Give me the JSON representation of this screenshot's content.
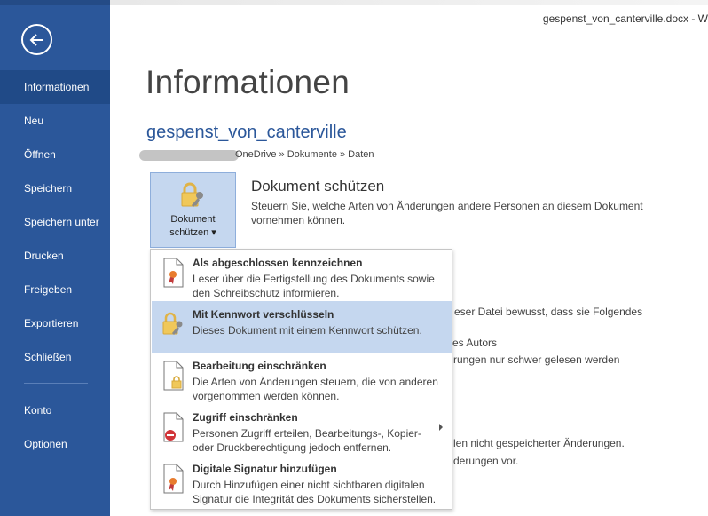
{
  "window": {
    "title": "gespenst_von_canterville.docx - W"
  },
  "sidebar": {
    "items": [
      {
        "label": "Informationen",
        "active": true
      },
      {
        "label": "Neu"
      },
      {
        "label": "Öffnen"
      },
      {
        "label": "Speichern"
      },
      {
        "label": "Speichern unter"
      },
      {
        "label": "Drucken"
      },
      {
        "label": "Freigeben"
      },
      {
        "label": "Exportieren"
      },
      {
        "label": "Schließen"
      },
      {
        "label": "Konto"
      },
      {
        "label": "Optionen"
      }
    ]
  },
  "main": {
    "heading": "Informationen",
    "doc_name": "gespenst_von_canterville",
    "doc_path": "OneDrive » Dokumente » Daten",
    "protect": {
      "button_line1": "Dokument",
      "button_line2": "schützen ▾",
      "title": "Dokument schützen",
      "description": "Steuern Sie, welche Arten von Änderungen andere Personen an diesem Dokument vornehmen können."
    },
    "background_fragments": [
      "eser Datei bewusst, dass sie Folgendes",
      "es Autors",
      "rungen nur schwer gelesen werden",
      "len nicht gespeicherter Änderungen.",
      "derungen vor."
    ]
  },
  "menu": {
    "items": [
      {
        "title": "Als abgeschlossen kennzeichnen",
        "desc": "Leser über die Fertigstellung des Dokuments sowie den Schreibschutz informieren.",
        "icon": "document-ribbon-icon"
      },
      {
        "title": "Mit Kennwort verschlüsseln",
        "desc": "Dieses Dokument mit einem Kennwort schützen.",
        "icon": "lock-key-icon",
        "highlighted": true
      },
      {
        "title": "Bearbeitung einschränken",
        "desc": "Die Arten von Änderungen steuern, die von anderen vorgenommen werden können.",
        "icon": "document-lock-icon"
      },
      {
        "title": "Zugriff einschränken",
        "desc": "Personen Zugriff erteilen, Bearbeitungs-, Kopier- oder Druckberechtigung jedoch entfernen.",
        "icon": "document-restricted-icon",
        "has_submenu": true
      },
      {
        "title": "Digitale Signatur hinzufügen",
        "desc": "Durch Hinzufügen einer nicht sichtbaren digitalen Signatur die Integrität des Dokuments sicherstellen.",
        "icon": "document-signature-icon"
      }
    ]
  },
  "colors": {
    "accent": "#2b579a",
    "highlight": "#c5d7ef"
  }
}
